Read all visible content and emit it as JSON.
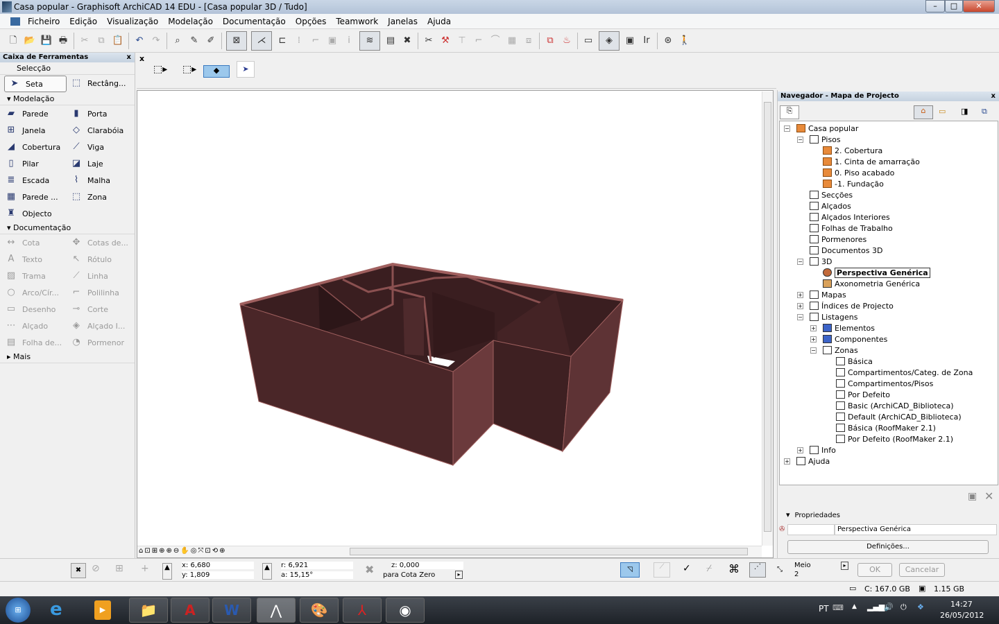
{
  "window": {
    "title": "Casa popular - Graphisoft ArchiCAD 14 EDU - [Casa popular 3D / Tudo]",
    "minimize": "–",
    "maximize": "□",
    "close": "✕"
  },
  "menu": [
    "Ficheiro",
    "Edição",
    "Visualização",
    "Modelação",
    "Documentação",
    "Opções",
    "Teamwork",
    "Janelas",
    "Ajuda"
  ],
  "toolbox": {
    "title": "Caixa de Ferramentas",
    "close": "x",
    "selection_label": "Selecção",
    "selection_tools": [
      {
        "label": "Seta",
        "icon": "arrow-icon"
      },
      {
        "label": "Rectâng...",
        "icon": "marquee-icon"
      }
    ],
    "modeling_label": "Modelação",
    "modeling_tools": [
      {
        "label": "Parede",
        "icon": "wall-icon"
      },
      {
        "label": "Porta",
        "icon": "door-icon"
      },
      {
        "label": "Janela",
        "icon": "window-icon"
      },
      {
        "label": "Clarabóia",
        "icon": "skylight-icon"
      },
      {
        "label": "Cobertura",
        "icon": "roof-icon"
      },
      {
        "label": "Viga",
        "icon": "beam-icon"
      },
      {
        "label": "Pilar",
        "icon": "column-icon"
      },
      {
        "label": "Laje",
        "icon": "slab-icon"
      },
      {
        "label": "Escada",
        "icon": "stair-icon"
      },
      {
        "label": "Malha",
        "icon": "mesh-icon"
      },
      {
        "label": "Parede ...",
        "icon": "curtain-wall-icon"
      },
      {
        "label": "Zona",
        "icon": "zone-icon"
      },
      {
        "label": "Objecto",
        "icon": "object-icon"
      }
    ],
    "documentation_label": "Documentação",
    "documentation_tools": [
      {
        "label": "Cota",
        "icon": "dimension-icon"
      },
      {
        "label": "Cotas de...",
        "icon": "level-dimension-icon"
      },
      {
        "label": "Texto",
        "icon": "text-icon"
      },
      {
        "label": "Rótulo",
        "icon": "label-icon"
      },
      {
        "label": "Trama",
        "icon": "fill-icon"
      },
      {
        "label": "Linha",
        "icon": "line-icon"
      },
      {
        "label": "Arco/Cír...",
        "icon": "arc-icon"
      },
      {
        "label": "Polilinha",
        "icon": "polyline-icon"
      },
      {
        "label": "Desenho",
        "icon": "drawing-icon"
      },
      {
        "label": "Corte",
        "icon": "section-icon"
      },
      {
        "label": "Alçado",
        "icon": "elevation-icon"
      },
      {
        "label": "Alçado I...",
        "icon": "interior-elevation-icon"
      },
      {
        "label": "Folha de...",
        "icon": "worksheet-icon"
      },
      {
        "label": "Pormenor",
        "icon": "detail-icon"
      }
    ],
    "more_label": "Mais"
  },
  "infobox": {
    "close": "x"
  },
  "navigator": {
    "title": "Navegador - Mapa de Projecto",
    "close": "x",
    "tree": [
      {
        "label": "Casa popular",
        "level": 0,
        "icon": "house",
        "exp": "-"
      },
      {
        "label": "Pisos",
        "level": 1,
        "icon": "doc",
        "exp": "-"
      },
      {
        "label": "2. Cobertura",
        "level": 2,
        "icon": "fl"
      },
      {
        "label": "1. Cinta de amarração",
        "level": 2,
        "icon": "fl"
      },
      {
        "label": "0. Piso acabado",
        "level": 2,
        "icon": "fl"
      },
      {
        "label": "-1. Fundação",
        "level": 2,
        "icon": "fl"
      },
      {
        "label": "Secções",
        "level": 1,
        "icon": "doc"
      },
      {
        "label": "Alçados",
        "level": 1,
        "icon": "doc"
      },
      {
        "label": "Alçados Interiores",
        "level": 1,
        "icon": "doc"
      },
      {
        "label": "Folhas de Trabalho",
        "level": 1,
        "icon": "doc"
      },
      {
        "label": "Pormenores",
        "level": 1,
        "icon": "doc"
      },
      {
        "label": "Documentos 3D",
        "level": 1,
        "icon": "doc"
      },
      {
        "label": "3D",
        "level": 1,
        "icon": "doc",
        "exp": "-"
      },
      {
        "label": "Perspectiva Genérica",
        "level": 2,
        "icon": "cam",
        "selected": true
      },
      {
        "label": "Axonometria Genérica",
        "level": 2,
        "icon": "box"
      },
      {
        "label": "Mapas",
        "level": 1,
        "icon": "doc",
        "exp": "+"
      },
      {
        "label": "Índices de Projecto",
        "level": 1,
        "icon": "doc",
        "exp": "+"
      },
      {
        "label": "Listagens",
        "level": 1,
        "icon": "doc",
        "exp": "-"
      },
      {
        "label": "Elementos",
        "level": 2,
        "icon": "lst",
        "exp": "+"
      },
      {
        "label": "Componentes",
        "level": 2,
        "icon": "lst",
        "exp": "+"
      },
      {
        "label": "Zonas",
        "level": 2,
        "icon": "doc",
        "exp": "-"
      },
      {
        "label": "Básica",
        "level": 3,
        "icon": "doc"
      },
      {
        "label": "Compartimentos/Categ. de Zona",
        "level": 3,
        "icon": "doc"
      },
      {
        "label": "Compartimentos/Pisos",
        "level": 3,
        "icon": "doc"
      },
      {
        "label": "Por Defeito",
        "level": 3,
        "icon": "doc"
      },
      {
        "label": "Basic (ArchiCAD_Biblioteca)",
        "level": 3,
        "icon": "doc"
      },
      {
        "label": "Default (ArchiCAD_Biblioteca)",
        "level": 3,
        "icon": "doc"
      },
      {
        "label": "Básica (RoofMaker 2.1)",
        "level": 3,
        "icon": "doc"
      },
      {
        "label": "Por Defeito (RoofMaker 2.1)",
        "level": 3,
        "icon": "doc"
      },
      {
        "label": "Info",
        "level": 1,
        "icon": "doc",
        "exp": "+"
      },
      {
        "label": "Ajuda",
        "level": 0,
        "icon": "doc",
        "exp": "+"
      }
    ],
    "properties_label": "Propriedades",
    "properties_value": "Perspectiva Genérica",
    "settings_button": "Definições..."
  },
  "coords": {
    "x": "x: 6,680",
    "y": "y: 1,809",
    "r": "r: 6,921",
    "a": "a: 15,15°",
    "z": "z: 0,000",
    "ref": "para Cota Zero",
    "snap_label": "Meio",
    "snap_value": "2",
    "ok": "OK",
    "cancel": "Cancelar"
  },
  "status": {
    "disk": "C: 167.0 GB",
    "memory": "1.15 GB"
  },
  "taskbar": {
    "lang": "PT",
    "time": "14:27",
    "date": "26/05/2012"
  },
  "model_colors": {
    "wall_front": "#4a2628",
    "wall_side": "#6b3a3c",
    "wall_top": "#a0605f",
    "interior": "#3a1e20"
  }
}
